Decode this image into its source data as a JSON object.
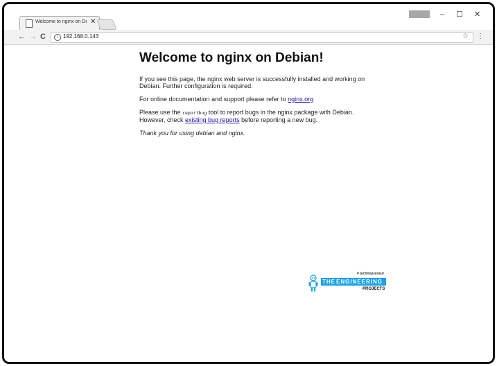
{
  "browser": {
    "tab_title": "Welcome to nginx on De",
    "tab_close": "✕",
    "url": "192.168.0.143",
    "info_icon": "i",
    "back_glyph": "←",
    "forward_glyph": "→",
    "reload_glyph": "C",
    "star_glyph": "☆",
    "menu_glyph": "⋮",
    "minimize_glyph": "–",
    "maximize_glyph": "☐",
    "close_glyph": "✕"
  },
  "page": {
    "heading": "Welcome to nginx on Debian!",
    "p1": "If you see this page, the nginx web server is successfully installed and working on Debian. Further configuration is required.",
    "p2_prefix": "For online documentation and support please refer to ",
    "p2_link": "nginx.org",
    "p3_prefix": "Please use the ",
    "p3_code": "reportbug",
    "p3_mid": " tool to report bugs in the nginx package with Debian. However, check ",
    "p3_link": "existing bug reports",
    "p3_suffix": " before reporting a new bug.",
    "thanks": "Thank you for using debian and nginx."
  },
  "watermark": {
    "tag": "# technopreneur",
    "the": "THE",
    "engineering": "ENGINEERING",
    "projects": "PROJECTS"
  },
  "colors": {
    "link": "#1a0dab",
    "logo_blue": "#1aa3e8",
    "frame": "#111111"
  },
  "icons": [
    "page-icon",
    "close-icon",
    "info-icon",
    "star-icon",
    "menu-icon",
    "robot-icon"
  ]
}
